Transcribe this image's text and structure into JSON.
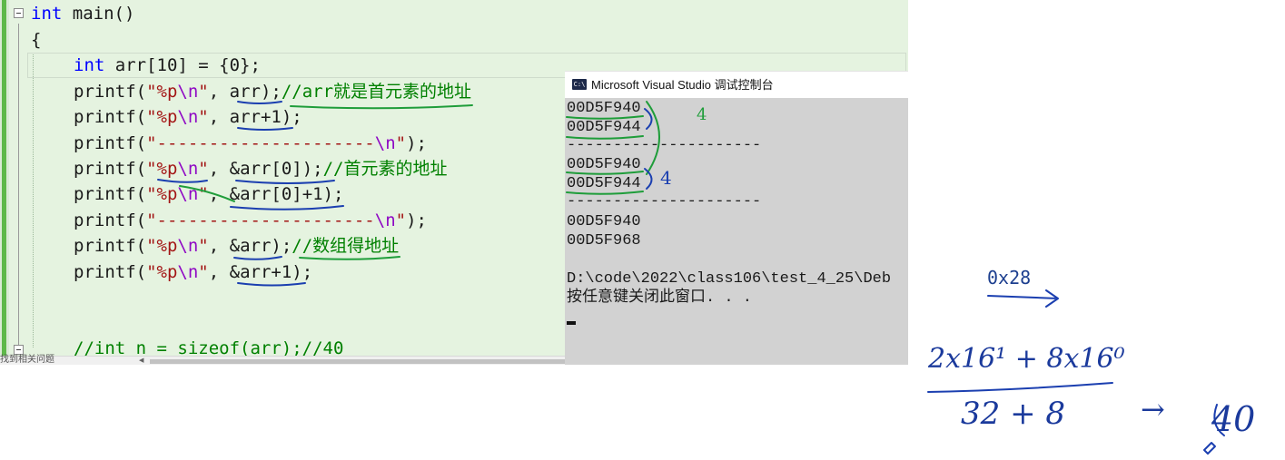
{
  "editor": {
    "lines": {
      "l1": {
        "type": "int",
        "name": " main()"
      },
      "l2": {
        "brace": "{"
      },
      "l3": {
        "type": "int",
        "rest": " arr[10] = {0};"
      },
      "l4": {
        "fn": "printf(",
        "str_a": "\"%p",
        "esc": "\\n",
        "str_b": "\"",
        "args": ", arr);",
        "comment": "//arr就是首元素的地址"
      },
      "l5": {
        "fn": "printf(",
        "str_a": "\"%p",
        "esc": "\\n",
        "str_b": "\"",
        "args": ", arr+1);"
      },
      "l6": {
        "fn": "printf(",
        "str_a": "\"---------------------",
        "esc": "\\n",
        "str_b": "\"",
        "args": ");"
      },
      "l7": {
        "fn": "printf(",
        "str_a": "\"%p",
        "esc": "\\n",
        "str_b": "\"",
        "args": ", &arr[0]);",
        "comment": "//首元素的地址"
      },
      "l8": {
        "fn": "printf(",
        "str_a": "\"%p",
        "esc": "\\n",
        "str_b": "\"",
        "args": ", &arr[0]+1);"
      },
      "l9": {
        "fn": "printf(",
        "str_a": "\"---------------------",
        "esc": "\\n",
        "str_b": "\"",
        "args": ");"
      },
      "l10": {
        "fn": "printf(",
        "str_a": "\"%p",
        "esc": "\\n",
        "str_b": "\"",
        "args": ", &arr);",
        "comment": "//数组得地址"
      },
      "l11": {
        "fn": "printf(",
        "str_a": "\"%p",
        "esc": "\\n",
        "str_b": "\"",
        "args": ", &arr+1);"
      },
      "l12": {
        "comment": "//int n = sizeof(arr);//40"
      }
    },
    "status_hint": "找到相关问题"
  },
  "console": {
    "title": "Microsoft Visual Studio 调试控制台",
    "icon_label": "C:\\",
    "lines": [
      "00D5F940",
      "00D5F944",
      "---------------------",
      "00D5F940",
      "00D5F944",
      "---------------------",
      "00D5F940",
      "00D5F968",
      "",
      "D:\\code\\2022\\class106\\test_4_25\\Deb",
      "按任意键关闭此窗口. . ."
    ]
  },
  "annotations": {
    "offset_label": "0x28",
    "diff_note_1": "4",
    "diff_note_2": "4",
    "numerator": "2x16¹ + 8x16⁰",
    "denominator": "32 + 8",
    "result_arrow": "→",
    "result": "40"
  },
  "colors": {
    "editor_bg": "#e5f3e0",
    "keyword": "#0000ff",
    "string": "#a31515",
    "escape": "#8f08c4",
    "comment": "#008000",
    "console_bg": "#d2d2d2",
    "ink_blue": "#1b3fb0",
    "ink_green": "#1f9d3a"
  }
}
